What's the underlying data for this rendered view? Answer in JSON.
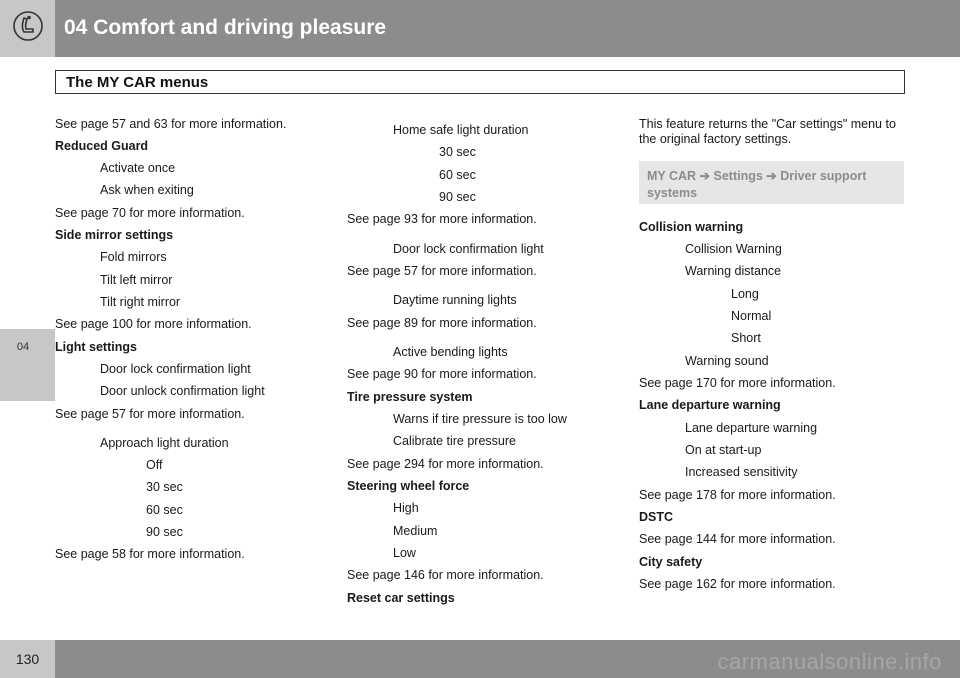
{
  "header": {
    "title": "04 Comfort and driving pleasure"
  },
  "section": {
    "title": "The MY CAR menus"
  },
  "side_tab": {
    "label": "04"
  },
  "footer": {
    "page_number": "130",
    "watermark": "carmanualsonline.info"
  },
  "col1": [
    "See page 57 and 63 for more information.",
    "Reduced Guard",
    "Activate once",
    "Ask when exiting",
    "See page 70 for more information.",
    "Side mirror settings",
    "Fold mirrors",
    "Tilt left mirror",
    "Tilt right mirror",
    "See page 100 for more information.",
    "Light settings",
    "Door lock confirmation light",
    "Door unlock confirmation light",
    "See page 57 for more information.",
    "Approach light duration",
    "Off",
    "30 sec",
    "60 sec",
    "90 sec",
    "See page 58 for more information."
  ],
  "col2": [
    "Home safe light duration",
    "30 sec",
    "60 sec",
    "90 sec",
    "See page 93 for more information.",
    "Door lock confirmation light",
    "See page 57 for more information.",
    "Daytime running lights",
    "See page 89 for more information.",
    "Active bending lights",
    "See page 90 for more information.",
    "Tire pressure system",
    "Warns if tire pressure is too low",
    "Calibrate tire pressure",
    "See page 294 for more information.",
    "Steering wheel force",
    "High",
    "Medium",
    "Low",
    "See page 146 for more information.",
    "Reset car settings"
  ],
  "col3": {
    "intro": "This feature returns the \"Car settings\" menu to the original factory settings.",
    "callout": "MY CAR ➔ Settings ➔ Driver support systems",
    "lines": [
      "Collision warning",
      "Collision Warning",
      "Warning distance",
      "Long",
      "Normal",
      "Short",
      "Warning sound",
      "See page 170 for more information.",
      "Lane departure warning",
      "Lane departure warning",
      "On at start-up",
      "Increased sensitivity",
      "See page 178 for more information.",
      "DSTC",
      "See page 144 for more information.",
      "City safety",
      "See page 162 for more information."
    ]
  },
  "icons": {
    "chapter": "seat-icon"
  },
  "colors": {
    "header_bg": "#8b8c8e",
    "tab_bg": "#c6c7c9",
    "callout_bg": "#e6e6e7"
  }
}
